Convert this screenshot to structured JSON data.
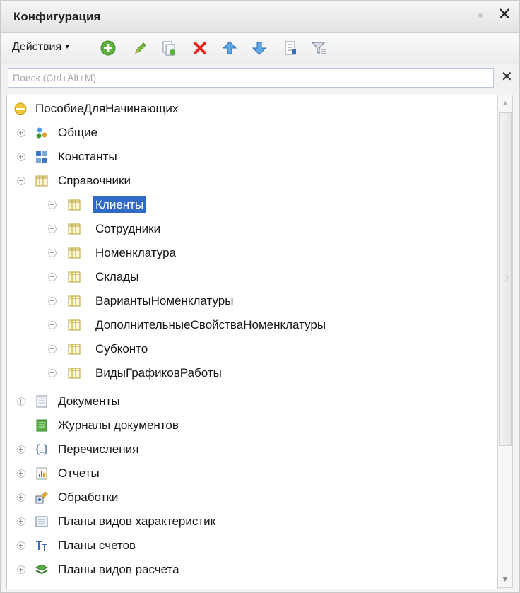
{
  "panel": {
    "title": "Конфигурация",
    "close_label": "✕"
  },
  "toolbar": {
    "actions_label": "Действия",
    "buttons": [
      "add-icon",
      "edit-pencil-icon",
      "copy-icon",
      "delete-icon",
      "move-up-icon",
      "move-down-icon",
      "sort-list-icon",
      "filter-icon"
    ]
  },
  "search": {
    "placeholder": "Поиск (Ctrl+Alt+M)",
    "value": "",
    "clear_label": "✕"
  },
  "tree": {
    "root": "ПособиеДляНачинающих",
    "items": [
      {
        "label": "Общие",
        "icon": "common-icon",
        "expanded": false
      },
      {
        "label": "Константы",
        "icon": "constants-icon",
        "expanded": false
      },
      {
        "label": "Справочники",
        "icon": "catalog-icon",
        "expanded": true
      }
    ],
    "catalogs": [
      {
        "label": "Клиенты",
        "selected": true
      },
      {
        "label": "Сотрудники",
        "selected": false
      },
      {
        "label": "Номенклатура",
        "selected": false
      },
      {
        "label": "Склады",
        "selected": false
      },
      {
        "label": "ВариантыНоменклатуры",
        "selected": false
      },
      {
        "label": "ДополнительныеСвойстваНоменклатуры",
        "selected": false
      },
      {
        "label": "Субконто",
        "selected": false
      },
      {
        "label": "ВидыГрафиковРаботы",
        "selected": false
      }
    ],
    "after": [
      {
        "label": "Документы",
        "icon": "document-icon",
        "has_expander": true
      },
      {
        "label": "Журналы документов",
        "icon": "journal-icon",
        "has_expander": false
      },
      {
        "label": "Перечисления",
        "icon": "enum-icon",
        "has_expander": true
      },
      {
        "label": "Отчеты",
        "icon": "report-icon",
        "has_expander": true
      },
      {
        "label": "Обработки",
        "icon": "processing-icon",
        "has_expander": true
      },
      {
        "label": "Планы видов характеристик",
        "icon": "characteristic-plan-icon",
        "has_expander": true
      },
      {
        "label": "Планы счетов",
        "icon": "chart-of-accounts-icon",
        "has_expander": true
      },
      {
        "label": "Планы видов расчета",
        "icon": "calculation-plan-icon",
        "has_expander": true
      }
    ]
  },
  "colors": {
    "selection": "#316ac5",
    "catalog_icon": "#c7b640"
  }
}
